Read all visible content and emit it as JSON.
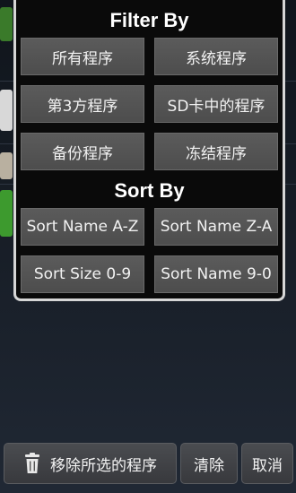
{
  "filter": {
    "title": "Filter By",
    "options": [
      "所有程序",
      "系统程序",
      "第3方程序",
      "SD卡中的程序",
      "备份程序",
      "冻结程序"
    ]
  },
  "sort": {
    "title": "Sort By",
    "options": [
      "Sort Name A-Z",
      "Sort Name Z-A",
      "Sort Size 0-9",
      "Sort Name 9-0"
    ]
  },
  "bottom_bar": {
    "remove_label": "移除所选的程序",
    "remove_icon": "trash-icon",
    "clear_label": "清除",
    "cancel_label": "取消"
  },
  "colors": {
    "popup_bg": "#0a0a0a",
    "popup_border": "#d6d6d6",
    "button_bg": "#555555",
    "text": "#f2f2f2"
  }
}
